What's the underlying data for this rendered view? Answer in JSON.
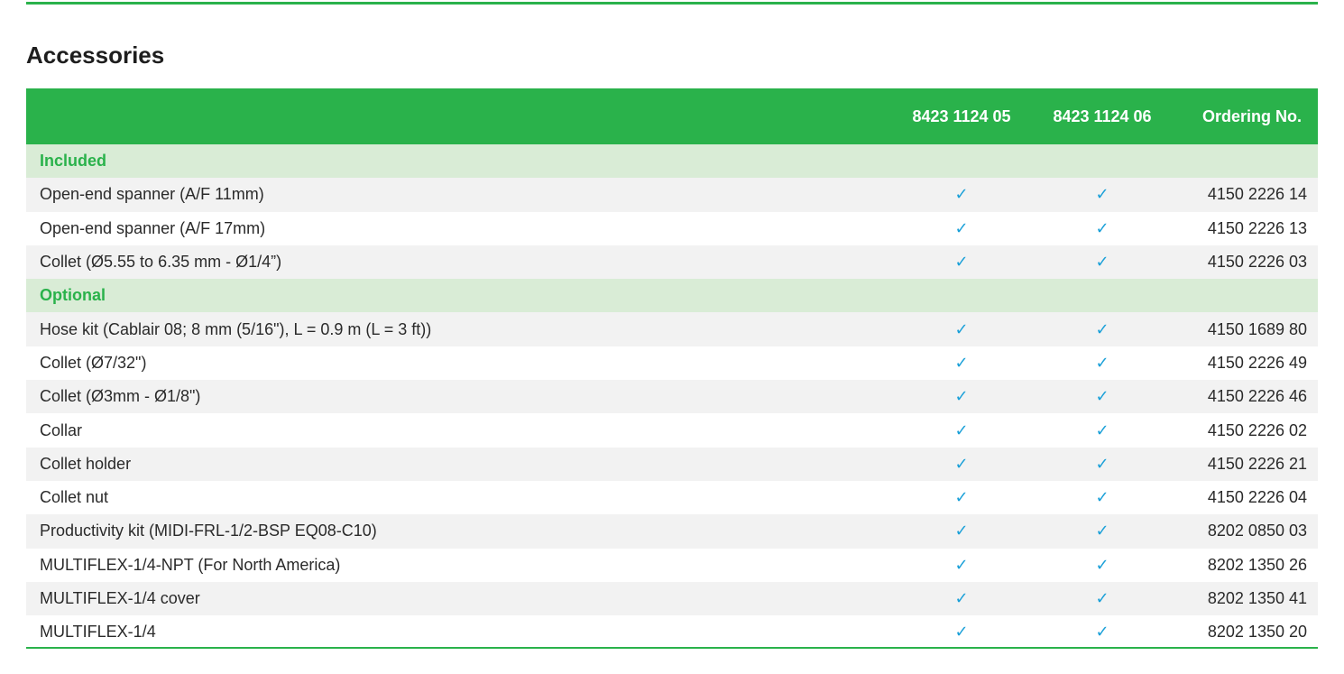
{
  "title": "Accessories",
  "table": {
    "headers": [
      "",
      "8423 1124 05",
      "8423 1124 06",
      "Ordering No."
    ],
    "check_glyph": "✓",
    "colors": {
      "accent": "#2ab24b",
      "section_bg": "#d9ecd6",
      "check": "#1aa0d8"
    },
    "sections": [
      {
        "label": "Included",
        "rows": [
          {
            "name": "Open-end spanner (A/F 11mm)",
            "c1": "✓",
            "c2": "✓",
            "ordering": "4150 2226 14"
          },
          {
            "name": "Open-end spanner (A/F 17mm)",
            "c1": "✓",
            "c2": "✓",
            "ordering": "4150 2226 13"
          },
          {
            "name": "Collet (Ø5.55 to 6.35 mm - Ø1/4”)",
            "c1": "✓",
            "c2": "✓",
            "ordering": "4150 2226 03"
          }
        ]
      },
      {
        "label": "Optional",
        "rows": [
          {
            "name": "Hose kit (Cablair 08; 8 mm (5/16\"), L = 0.9 m (L = 3 ft))",
            "c1": "✓",
            "c2": "✓",
            "ordering": "4150 1689 80"
          },
          {
            "name": "Collet (Ø7/32\")",
            "c1": "✓",
            "c2": "✓",
            "ordering": "4150 2226 49"
          },
          {
            "name": "Collet (Ø3mm - Ø1/8\")",
            "c1": "✓",
            "c2": "✓",
            "ordering": "4150 2226 46"
          },
          {
            "name": "Collar",
            "c1": "✓",
            "c2": "✓",
            "ordering": "4150 2226 02"
          },
          {
            "name": "Collet holder",
            "c1": "✓",
            "c2": "✓",
            "ordering": "4150 2226 21"
          },
          {
            "name": "Collet nut",
            "c1": "✓",
            "c2": "✓",
            "ordering": "4150 2226 04"
          },
          {
            "name": "Productivity kit (MIDI-FRL-1/2-BSP EQ08-C10)",
            "c1": "✓",
            "c2": "✓",
            "ordering": "8202 0850 03"
          },
          {
            "name": "MULTIFLEX-1/4-NPT (For North America)",
            "c1": "✓",
            "c2": "✓",
            "ordering": "8202 1350 26"
          },
          {
            "name": "MULTIFLEX-1/4 cover",
            "c1": "✓",
            "c2": "✓",
            "ordering": "8202 1350 41"
          },
          {
            "name": "MULTIFLEX-1/4",
            "c1": "✓",
            "c2": "✓",
            "ordering": "8202 1350 20"
          }
        ]
      }
    ]
  }
}
